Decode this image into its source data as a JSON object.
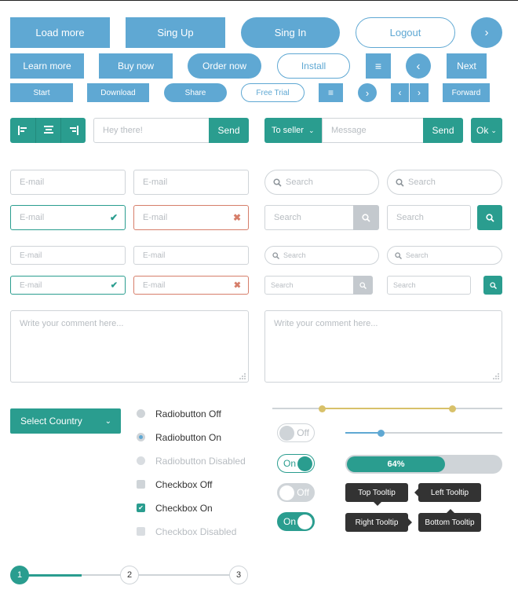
{
  "buttons": {
    "load_more": "Load more",
    "sign_up": "Sing Up",
    "sign_in": "Sing In",
    "logout": "Logout",
    "learn_more": "Learn more",
    "buy_now": "Buy now",
    "order_now": "Order now",
    "install": "Install",
    "next": "Next",
    "start": "Start",
    "download": "Download",
    "share": "Share",
    "free_trial": "Free Trial",
    "forward": "Forward"
  },
  "message_bar": {
    "placeholder": "Hey there!",
    "send": "Send"
  },
  "seller_bar": {
    "dropdown": "To seller",
    "placeholder": "Message",
    "send": "Send",
    "ok": "Ok"
  },
  "fields": {
    "email_placeholder": "E-mail",
    "search_placeholder": "Search"
  },
  "comments": {
    "placeholder": "Write your comment here..."
  },
  "select": {
    "label": "Select Country"
  },
  "options": [
    {
      "label": "Radiobutton Off"
    },
    {
      "label": "Radiobutton On"
    },
    {
      "label": "Radiobutton Disabled"
    },
    {
      "label": "Checkbox Off"
    },
    {
      "label": "Checkbox On"
    },
    {
      "label": "Checkbox Disabled"
    }
  ],
  "toggles": {
    "off": "Off",
    "on": "On"
  },
  "progress": {
    "value_label": "64%",
    "value_fraction": 0.64
  },
  "tooltips": {
    "top": "Top Tooltip",
    "left": "Left Tooltip",
    "right": "Right Tooltip",
    "bottom": "Bottom Tooltip"
  },
  "stepper": {
    "steps": [
      "1",
      "2",
      "3"
    ]
  },
  "colors": {
    "blue": "#5fa8d3",
    "teal": "#2a9d8f",
    "yellow": "#d8c16a",
    "error": "#d67e6a",
    "dark": "#333333",
    "gray": "#cfd4d8"
  }
}
